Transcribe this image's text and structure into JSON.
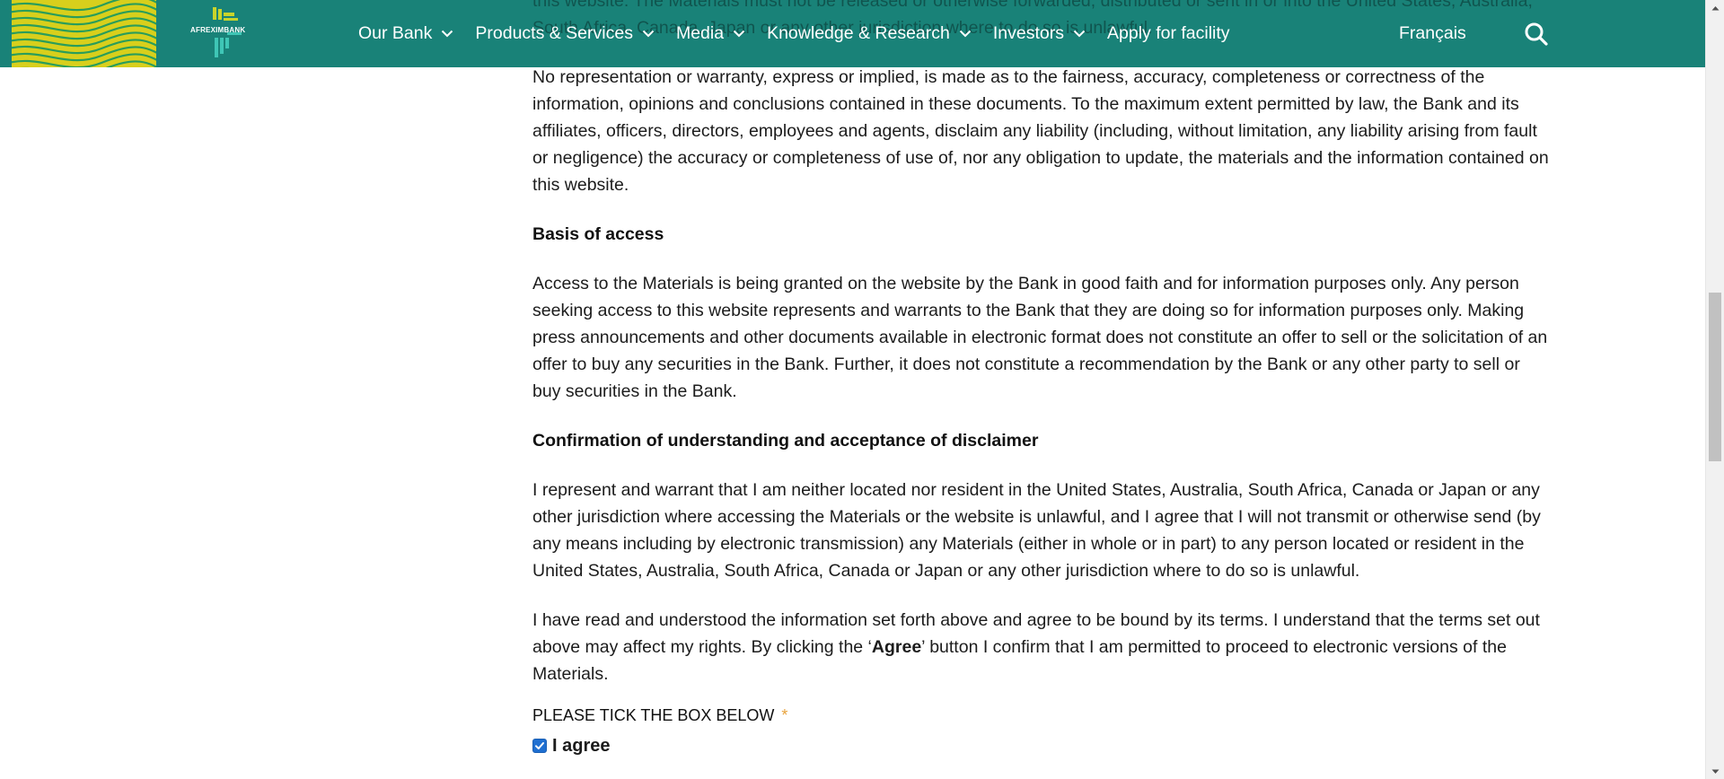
{
  "header": {
    "logo_text": "AFREXIMBANK",
    "nav": [
      {
        "label": "Our Bank",
        "has_dropdown": true
      },
      {
        "label": "Products & Services",
        "has_dropdown": true
      },
      {
        "label": "Media",
        "has_dropdown": true
      },
      {
        "label": "Knowledge & Research",
        "has_dropdown": true
      },
      {
        "label": "Investors",
        "has_dropdown": true
      },
      {
        "label": "Apply for facility",
        "has_dropdown": false
      }
    ],
    "language": "Français",
    "search_icon": "search-icon",
    "brand_color": "#198278",
    "pattern_colors": [
      "#d8cf1c",
      "#2a9d5a"
    ]
  },
  "content": {
    "obscured_top": "this website. The Materials must not be released or otherwise forwarded, distributed or sent in or into the United States, Australia, South Africa, Canada, Japan or any other jurisdiction where to do so is unlawful.",
    "p_representation": "No representation or warranty, express or implied, is made as to the fairness, accuracy, completeness or correctness of the information, opinions and conclusions contained in these documents. To the maximum extent permitted by law, the Bank and its affiliates, officers, directors, employees and agents, disclaim any liability (including, without limitation, any liability arising from fault or negligence) the accuracy or completeness of use of, nor any obligation to update, the materials and the information contained on this website.",
    "h_basis": "Basis of access",
    "p_basis": "Access to the Materials is being granted on the website by the Bank in good faith and for information purposes only. Any person seeking access to this website represents and warrants to the Bank that they are doing so for information purposes only. Making press announcements and other documents available in electronic format does not constitute an offer to sell or the solicitation of an offer to buy any securities in the Bank. Further, it does not constitute a recommendation by the Bank or any other party to sell or buy securities in the Bank.",
    "h_confirmation": "Confirmation of understanding and acceptance of disclaimer",
    "p_represent": "I represent and warrant that I am neither located nor resident in the United States, Australia, South Africa, Canada or Japan or any other jurisdiction where accessing the Materials or the website is unlawful, and I agree that I will not transmit or otherwise send (by any means including by electronic transmission) any Materials (either in whole or in part) to any person located or resident in the United States, Australia, South Africa, Canada or Japan or any other jurisdiction where to do so is unlawful.",
    "p_read_1": "I have read and understood the information set forth above and agree to be bound by its terms. I understand that the terms set out above may affect my rights. By clicking the ‘",
    "p_read_agree": "Agree",
    "p_read_2": "’ button I confirm that I am permitted to proceed to electronic versions of the Materials.",
    "tick_label": "PLEASE TICK THE BOX BELOW",
    "required_mark": "*",
    "checkbox_label": "I agree",
    "checkbox_checked": true
  }
}
